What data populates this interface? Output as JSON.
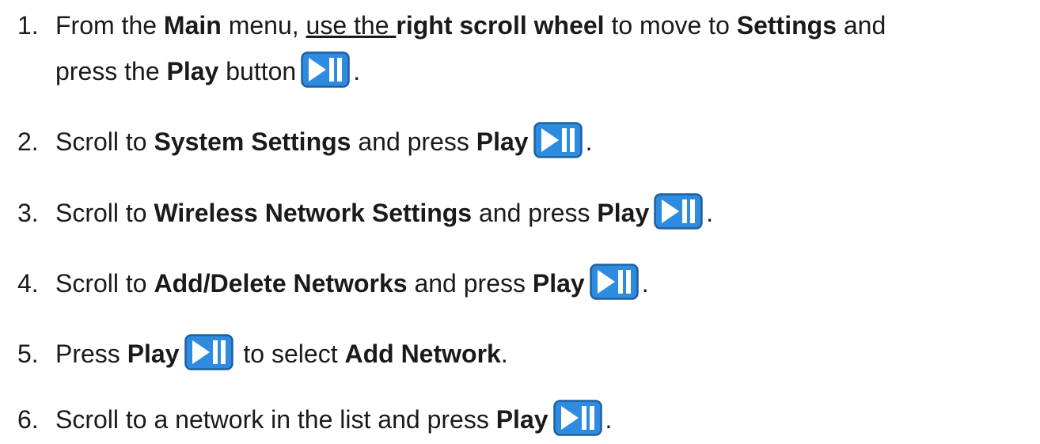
{
  "steps": [
    {
      "number": "1.",
      "line1": {
        "t1": "From the ",
        "b1": "Main",
        "t2": " menu, ",
        "u1": "use the ",
        "b2": "right scroll wheel",
        "t3": " to move to ",
        "b3": "Settings",
        "t4": " and"
      },
      "line2": {
        "t1": "press the ",
        "b1": "Play",
        "t2": " button",
        "icon": "play-pause-icon",
        "t3": "."
      }
    },
    {
      "number": "2.",
      "t1": "Scroll to ",
      "b1": "System Settings",
      "t2": " and press ",
      "b2": "Play",
      "icon": "play-pause-icon",
      "t3": "."
    },
    {
      "number": "3.",
      "t1": "Scroll to ",
      "b1": "Wireless Network Settings",
      "t2": " and press ",
      "b2": "Play",
      "icon": "play-pause-icon",
      "t3": "."
    },
    {
      "number": "4.",
      "t1": "Scroll to ",
      "b1": "Add/Delete Networks",
      "t2": " and press ",
      "b2": "Play",
      "icon": "play-pause-icon",
      "t3": "."
    },
    {
      "number": "5.",
      "t1": "Press ",
      "b1": "Play",
      "icon": "play-pause-icon",
      "t2": " to select ",
      "b2": "Add Network",
      "t3": "."
    },
    {
      "number": "6.",
      "t1": "Scroll to a network in the list and press ",
      "b1": "Play",
      "icon": "play-pause-icon",
      "t2": "."
    }
  ],
  "colors": {
    "icon_fill": "#2e8ce0",
    "icon_border": "#1f5fa0",
    "icon_glyph": "#ffffff",
    "text": "#1a1a1a"
  }
}
